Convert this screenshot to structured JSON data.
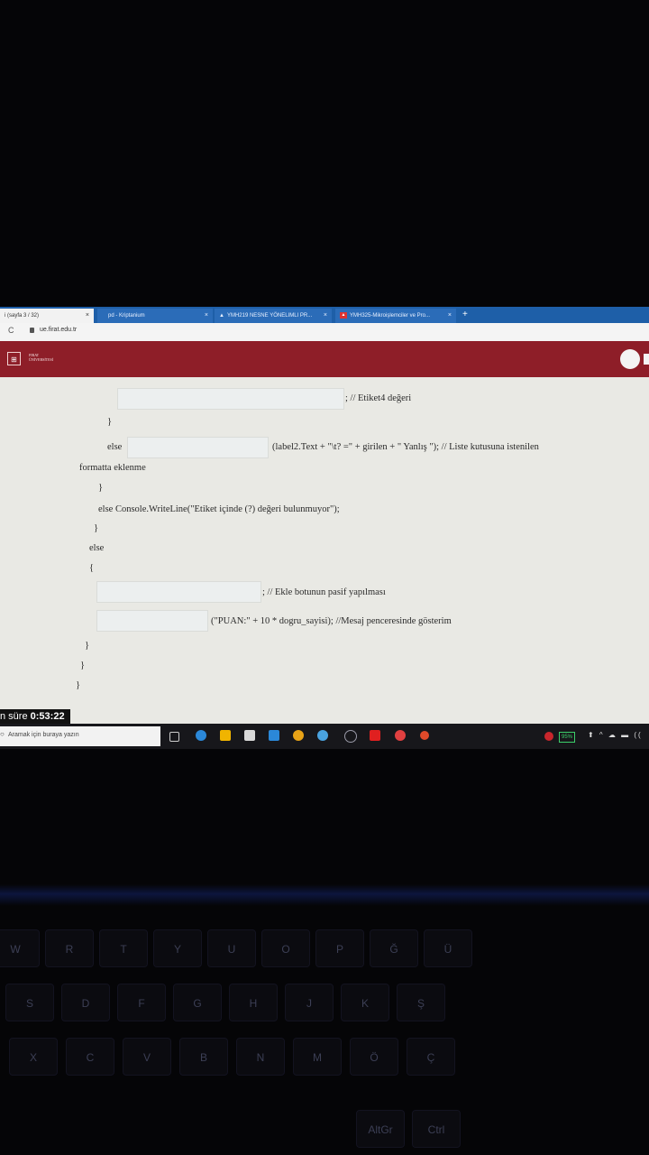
{
  "browser": {
    "tabs": [
      {
        "title": "i (sayfa 3 / 32)",
        "close": "×",
        "active": true
      },
      {
        "title": "pd - Kriptanium",
        "close": "×",
        "active": false
      },
      {
        "title": "YMH219 NESNE YÖNELIMLI PR...",
        "close": "×",
        "active": false
      },
      {
        "title": "YMH325-Mikroişlemciler ve Pro...",
        "close": "×",
        "active": false
      }
    ],
    "new_tab": "+",
    "reload": "C",
    "url": "ue.firat.edu.tr"
  },
  "site": {
    "logo_glyph": "⊞",
    "university_line1": "FIRAT",
    "university_line2": "ÜNİVERSİTESİ"
  },
  "document": {
    "line1_suffix": "; // Etiket4 değeri",
    "line2": "}",
    "line3_prefix": "else",
    "line3_suffix": "(label2.Text + \"\\t? =\" + girilen + \" Yanlış \"); // Liste kutusuna istenilen",
    "line4": "formatta eklenme",
    "line5": "}",
    "line6": "else Console.WriteLine(\"Etiket içinde (?) değeri bulunmuyor\");",
    "line7": "}",
    "line8": "else",
    "line9": "{",
    "line10_suffix": "; // Ekle botunun pasif yapılması",
    "line11_suffix": "(\"PUAN:\" + 10 * dogru_sayisi); //Mesaj penceresinde gösterim",
    "line12": "}",
    "line13": "}",
    "line14": "}"
  },
  "timer": {
    "label": "n süre",
    "value": "0:53:22"
  },
  "taskbar": {
    "search_icon": "magnifier-icon",
    "search_placeholder": "Aramak için buraya yazın",
    "battery": "95%",
    "tray_symbols": "⬆ ^ ☁ ▬ ((",
    "app_colors": [
      "#2b88d8",
      "#f0b400",
      "#d9d9d9",
      "#2b88d8",
      "#e8a317",
      "#4aa3df",
      "#9a9aa8",
      "#e02020",
      "#e04040",
      "#e04a2a"
    ]
  },
  "keyboard": {
    "row1": [
      "W",
      "R",
      "T",
      "Y",
      "U",
      "O",
      "P",
      "Ğ",
      "Ü"
    ],
    "row2": [
      "S",
      "D",
      "F",
      "G",
      "H",
      "J",
      "K",
      "Ş"
    ],
    "row3": [
      "X",
      "C",
      "V",
      "B",
      "N",
      "M",
      "Ö",
      "Ç"
    ],
    "row4": [
      "AltGr",
      "Ctrl"
    ]
  }
}
